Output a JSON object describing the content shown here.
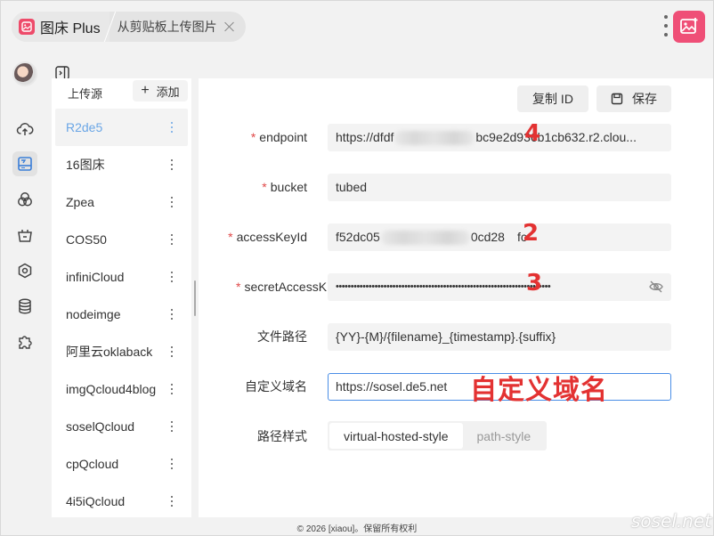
{
  "app": {
    "title": "图床 Plus",
    "active_tab": "从剪贴板上传图片"
  },
  "panel": {
    "header_label": "上传源",
    "add_label": "添加",
    "items": [
      {
        "label": "R2de5"
      },
      {
        "label": "16图床"
      },
      {
        "label": "Zpea"
      },
      {
        "label": "COS50"
      },
      {
        "label": "infiniCloud"
      },
      {
        "label": "nodeimge"
      },
      {
        "label": "阿里云oklaback"
      },
      {
        "label": "imgQcloud4blog"
      },
      {
        "label": "soselQcloud"
      },
      {
        "label": "cpQcloud"
      },
      {
        "label": "4i5iQcloud"
      }
    ]
  },
  "toolbar": {
    "copy_id_label": "复制 ID",
    "save_label": "保存"
  },
  "form": {
    "endpoint": {
      "label": "endpoint",
      "value_start": "https://dfdf",
      "value_end": "bc9e2d9",
      "value_tail": "36b1cb632.r2.clou..."
    },
    "bucket": {
      "label": "bucket",
      "value": "tubed"
    },
    "access_key": {
      "label": "accessKeyId",
      "value_start": "f52dc05",
      "value_end": "0cd28",
      "value_tail": "fc"
    },
    "secret_key": {
      "label": "secretAccessKey",
      "value": "••••••••••••••••••••••••••••••••••••••••••••••••••••••••••••••••••••••••"
    },
    "path": {
      "label": "文件路径",
      "value": "{YY}-{M}/{filename}_{timestamp}.{suffix}"
    },
    "domain": {
      "label": "自定义域名",
      "value": "https://sosel.de5.net"
    },
    "style": {
      "label": "路径样式",
      "options": [
        "virtual-hosted-style",
        "path-style"
      ]
    }
  },
  "annotations": {
    "n4": "4",
    "n2": "2",
    "n3": "3",
    "domain_note": "自定义域名"
  },
  "footer": "© 2026 [xiaou]。保留所有权利",
  "watermark": "sosel.net",
  "colors": {
    "accent": "#6aa6e6",
    "required": "#e04848",
    "annotation": "#e33232",
    "brand": "#ef4f77"
  }
}
